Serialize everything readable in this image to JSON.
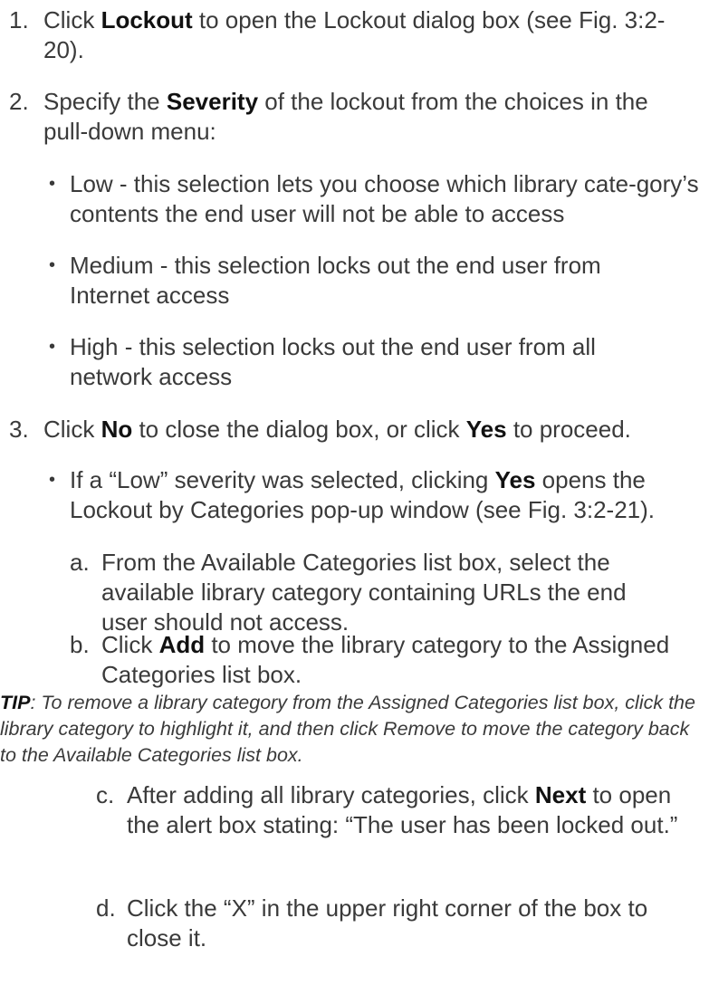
{
  "steps": [
    {
      "num": "1.",
      "pre": "Click ",
      "bold": "Lockout",
      "post": " to open the Lockout dialog box (see Fig. 3:2-20)."
    },
    {
      "num": "2.",
      "pre": "Specify the ",
      "bold": "Severity",
      "post": " of the lockout from the choices in the pull-down menu:"
    },
    {
      "num": "3.",
      "pre": "Click ",
      "bold": "No",
      "mid": " to close the dialog box, or click ",
      "bold2": "Yes",
      "post": " to proceed."
    }
  ],
  "severity_bullets": [
    "Low - this selection lets you choose which library cate-gory’s contents the end user will not be able to access",
    "Medium - this selection locks out the end user from Internet access",
    "High - this selection locks out the end user from all network access"
  ],
  "bullet_glyph": "•",
  "low_bullet": {
    "pre": "If a “Low” severity was selected, clicking ",
    "bold": "Yes",
    "post": " opens the Lockout by Categories pop-up window (see Fig. 3:2-21)."
  },
  "substeps": [
    {
      "letter": "a.",
      "text": "From the Available Categories list box, select the available library category containing URLs the end user should not access."
    },
    {
      "letter": "b.",
      "pre": "Click ",
      "bold": "Add",
      "post": " to move the library category to the Assigned Categories list box."
    },
    {
      "letter": "c.",
      "pre": "After adding all library categories, click ",
      "bold": "Next",
      "post": " to open the alert box stating: “The user has been locked out.”"
    },
    {
      "letter": "d.",
      "text": "Click the “X” in the upper right corner of the box to close it."
    }
  ],
  "tip": {
    "label": "TIP",
    "text": ": To remove a library category from the Assigned Categories list box, click the library category to highlight it, and then click Remove to move the category back to the Available Categories list box."
  }
}
